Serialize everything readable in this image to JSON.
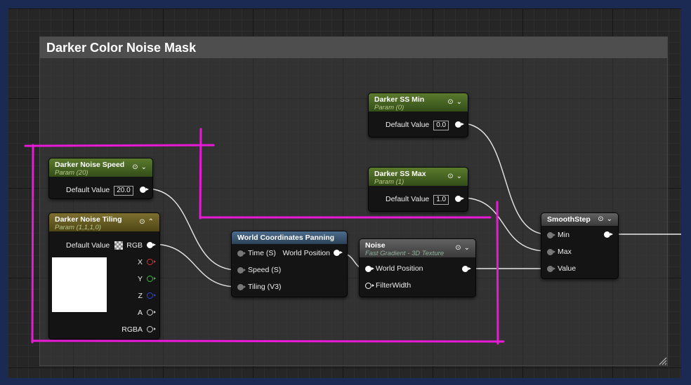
{
  "comment": {
    "title": "Darker Color Noise Mask"
  },
  "nodes": {
    "noise_speed": {
      "title": "Darker Noise Speed",
      "subtitle": "Param (20)",
      "default_label": "Default Value",
      "default_value": "20.0"
    },
    "noise_tiling": {
      "title": "Darker Noise Tiling",
      "subtitle": "Param (1,1,1,0)",
      "default_label": "Default Value",
      "outputs": [
        "RGB",
        "X",
        "Y",
        "Z",
        "A",
        "RGBA"
      ]
    },
    "ss_min": {
      "title": "Darker SS Min",
      "subtitle": "Param (0)",
      "default_label": "Default Value",
      "default_value": "0.0"
    },
    "ss_max": {
      "title": "Darker SS Max",
      "subtitle": "Param (1)",
      "default_label": "Default Value",
      "default_value": "1.0"
    },
    "wcp": {
      "title": "World Coordinates Panning",
      "inputs": [
        "Time (S)",
        "Speed (S)",
        "Tiling (V3)"
      ],
      "output": "World Position"
    },
    "noise": {
      "title": "Noise",
      "subtitle": "Fast Gradient - 3D Texture",
      "inputs": [
        "World Position",
        "FilterWidth"
      ]
    },
    "smoothstep": {
      "title": "SmoothStep",
      "inputs": [
        "Min",
        "Max",
        "Value"
      ]
    }
  },
  "icons": {
    "pin_toggle": "circle-arrow-icon",
    "collapse": "chevron-down-icon",
    "expand": "chevron-up-icon"
  },
  "colors": {
    "annotation": "#e81ad6",
    "background": "#1b2a52",
    "x_channel": "#e03030",
    "y_channel": "#30c030",
    "z_channel": "#3040e0"
  }
}
